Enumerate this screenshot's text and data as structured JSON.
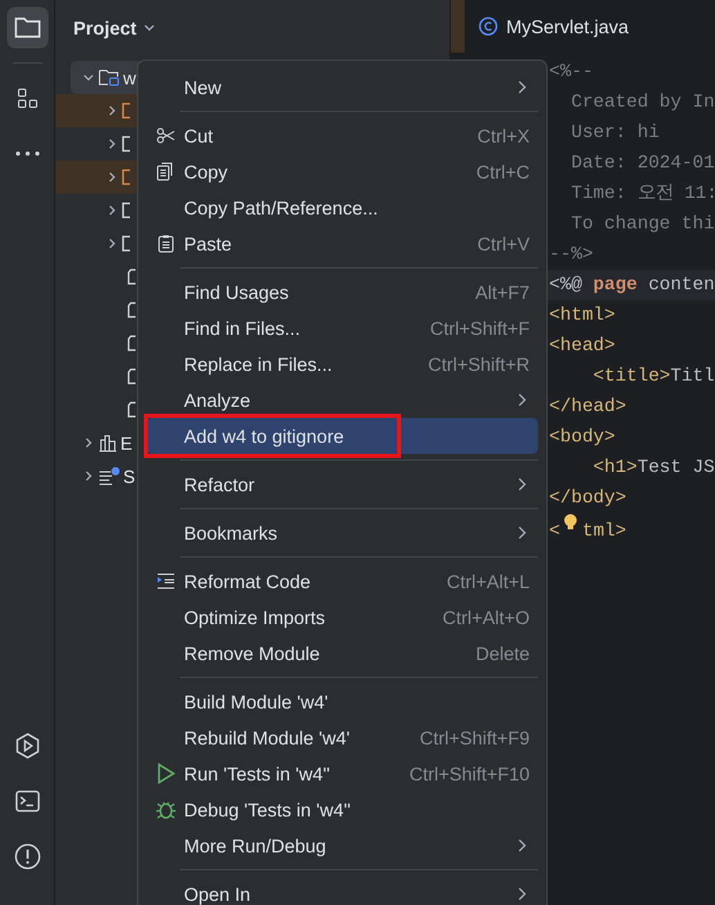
{
  "panel": {
    "title": "Project"
  },
  "tree": [
    {
      "label": "w",
      "expanded": true,
      "selected": true,
      "kind": "module",
      "children": [
        {
          "kind": "folder",
          "excluded": true
        },
        {
          "kind": "folder",
          "excluded": false
        },
        {
          "kind": "folder",
          "excluded": true
        },
        {
          "kind": "folder",
          "excluded": false
        },
        {
          "kind": "folder",
          "excluded": false
        },
        {
          "kind": "file"
        },
        {
          "kind": "file"
        },
        {
          "kind": "file"
        },
        {
          "kind": "file"
        },
        {
          "kind": "file"
        }
      ]
    },
    {
      "label": "E",
      "expanded": false,
      "selected": false,
      "kind": "library"
    },
    {
      "label": "S",
      "expanded": false,
      "selected": false,
      "kind": "scratch"
    }
  ],
  "editor_tab": {
    "title": "MyServlet.java"
  },
  "code": [
    {
      "segments": [
        {
          "text": "<%--",
          "kind": "comment"
        }
      ],
      "current": false
    },
    {
      "segments": [
        {
          "text": "  Created by In",
          "kind": "comment"
        }
      ],
      "current": false
    },
    {
      "segments": [
        {
          "text": "  User: hi",
          "kind": "comment"
        }
      ],
      "current": false
    },
    {
      "segments": [
        {
          "text": "  Date: 2024-01",
          "kind": "comment"
        }
      ],
      "current": false
    },
    {
      "segments": [
        {
          "text": "  Time: 오전 11:",
          "kind": "comment"
        }
      ],
      "current": false
    },
    {
      "segments": [
        {
          "text": "  To change thi",
          "kind": "comment"
        }
      ],
      "current": false
    },
    {
      "segments": [
        {
          "text": "--%>",
          "kind": "comment"
        }
      ],
      "current": false
    },
    {
      "segments": [
        {
          "text": "<%@ ",
          "kind": "plain"
        },
        {
          "text": "page",
          "kind": "keyword"
        },
        {
          "text": " conten",
          "kind": "plain"
        }
      ],
      "current": true
    },
    {
      "segments": [
        {
          "text": "<html>",
          "kind": "tag"
        }
      ],
      "current": false
    },
    {
      "segments": [
        {
          "text": "<head>",
          "kind": "tag"
        }
      ],
      "current": false
    },
    {
      "segments": [
        {
          "text": "    <title>",
          "kind": "tag"
        },
        {
          "text": "Titl",
          "kind": "plain"
        }
      ],
      "current": false
    },
    {
      "segments": [
        {
          "text": "</head>",
          "kind": "tag"
        }
      ],
      "current": false
    },
    {
      "segments": [
        {
          "text": "<body>",
          "kind": "tag"
        }
      ],
      "current": false
    },
    {
      "segments": [
        {
          "text": "    <h1>",
          "kind": "tag"
        },
        {
          "text": "Test JS",
          "kind": "plain"
        }
      ],
      "current": false
    },
    {
      "segments": [
        {
          "text": "</body>",
          "kind": "tag"
        }
      ],
      "current": false
    },
    {
      "segments": [
        {
          "text": "<",
          "kind": "tag"
        },
        {
          "text": "tml>",
          "kind": "tag"
        }
      ],
      "current": false,
      "bulb": true
    }
  ],
  "menu": [
    {
      "kind": "item",
      "label": "New",
      "submenu": true,
      "selected": false
    },
    {
      "kind": "separator"
    },
    {
      "kind": "scissors",
      "label": "Cut",
      "shortcut": "Ctrl+X",
      "selected": false
    },
    {
      "kind": "copy",
      "label": "Copy",
      "shortcut": "Ctrl+C",
      "selected": false
    },
    {
      "kind": "item",
      "label": "Copy Path/Reference...",
      "selected": false
    },
    {
      "kind": "paste",
      "label": "Paste",
      "shortcut": "Ctrl+V",
      "selected": false
    },
    {
      "kind": "separator"
    },
    {
      "kind": "item",
      "label": "Find Usages",
      "shortcut": "Alt+F7",
      "selected": false
    },
    {
      "kind": "item",
      "label": "Find in Files...",
      "shortcut": "Ctrl+Shift+F",
      "selected": false
    },
    {
      "kind": "item",
      "label": "Replace in Files...",
      "shortcut": "Ctrl+Shift+R",
      "selected": false
    },
    {
      "kind": "item",
      "label": "Analyze",
      "submenu": true,
      "selected": false
    },
    {
      "kind": "item",
      "label": "Add w4 to gitignore",
      "selected": true,
      "annotated": true
    },
    {
      "kind": "separator"
    },
    {
      "kind": "item",
      "label": "Refactor",
      "submenu": true,
      "selected": false
    },
    {
      "kind": "separator"
    },
    {
      "kind": "item",
      "label": "Bookmarks",
      "submenu": true,
      "selected": false
    },
    {
      "kind": "separator"
    },
    {
      "kind": "reformat",
      "label": "Reformat Code",
      "shortcut": "Ctrl+Alt+L",
      "selected": false
    },
    {
      "kind": "item",
      "label": "Optimize Imports",
      "shortcut": "Ctrl+Alt+O",
      "selected": false
    },
    {
      "kind": "item",
      "label": "Remove Module",
      "shortcut": "Delete",
      "selected": false
    },
    {
      "kind": "separator"
    },
    {
      "kind": "item",
      "label": "Build Module 'w4'",
      "selected": false
    },
    {
      "kind": "item",
      "label": "Rebuild Module 'w4'",
      "shortcut": "Ctrl+Shift+F9",
      "selected": false
    },
    {
      "kind": "run",
      "label": "Run 'Tests in 'w4''",
      "shortcut": "Ctrl+Shift+F10",
      "selected": false
    },
    {
      "kind": "debug",
      "label": "Debug 'Tests in 'w4''",
      "selected": false
    },
    {
      "kind": "item",
      "label": "More Run/Debug",
      "submenu": true,
      "selected": false
    },
    {
      "kind": "separator"
    },
    {
      "kind": "item",
      "label": "Open In",
      "submenu": true,
      "selected": false
    }
  ]
}
